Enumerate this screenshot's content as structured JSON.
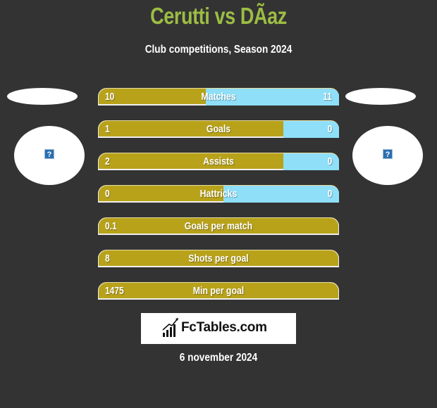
{
  "header": {
    "title": "Cerutti vs DÃaz",
    "subtitle": "Club competitions, Season 2024"
  },
  "players": {
    "left": {
      "image_icon": "broken-image-icon",
      "placeholder_glyph": "?"
    },
    "right": {
      "image_icon": "broken-image-icon",
      "placeholder_glyph": "?"
    }
  },
  "colors": {
    "left_bar": "#b8a21a",
    "right_bar": "#8fdff8",
    "title": "#9cbd44",
    "background": "#333333"
  },
  "stats": [
    {
      "label": "Matches",
      "left": "10",
      "right": "11",
      "left_share": 0.447
    },
    {
      "label": "Goals",
      "left": "1",
      "right": "0",
      "left_share": 0.77
    },
    {
      "label": "Assists",
      "left": "2",
      "right": "0",
      "left_share": 0.77
    },
    {
      "label": "Hattricks",
      "left": "0",
      "right": "0",
      "left_share": 0.52
    },
    {
      "label": "Goals per match",
      "left": "0.1",
      "right": "",
      "left_share": 1
    },
    {
      "label": "Shots per goal",
      "left": "8",
      "right": "",
      "left_share": 1
    },
    {
      "label": "Min per goal",
      "left": "1475",
      "right": "",
      "left_share": 1
    }
  ],
  "footer": {
    "logo_text": "FcTables.com",
    "logo_icon": "bar-chart-icon",
    "date": "6 november 2024"
  }
}
